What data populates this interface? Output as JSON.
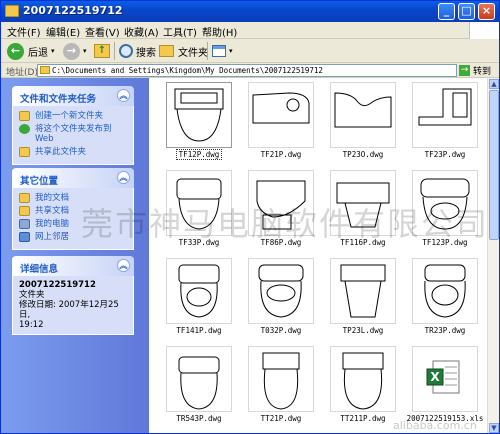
{
  "window": {
    "title": "2007122519712"
  },
  "menu": [
    "文件(F)",
    "编辑(E)",
    "查看(V)",
    "收藏(A)",
    "工具(T)",
    "帮助(H)"
  ],
  "toolbar": {
    "back": "后退",
    "search": "搜索",
    "folders": "文件夹"
  },
  "address": {
    "label": "地址(D)",
    "path": "C:\\Documents and Settings\\Kingdom\\My Documents\\2007122519712",
    "go": "转到"
  },
  "tasks": {
    "title": "文件和文件夹任务",
    "items": [
      "创建一个新文件夹",
      "将这个文件夹发布到",
      "Web",
      "共享此文件夹"
    ]
  },
  "places": {
    "title": "其它位置",
    "items": [
      "我的文档",
      "共享文档",
      "我的电脑",
      "网上邻居"
    ]
  },
  "details": {
    "title": "详细信息",
    "name": "2007122519712",
    "type": "文件夹",
    "modified": "修改日期: 2007年12月25日,",
    "time": "19:12"
  },
  "files": [
    {
      "name": "TF12P.dwg",
      "selected": true
    },
    {
      "name": "TF21P.dwg"
    },
    {
      "name": "TP23O.dwg"
    },
    {
      "name": "TF23P.dwg"
    },
    {
      "name": "TF33P.dwg"
    },
    {
      "name": "TF86P.dwg"
    },
    {
      "name": "TF116P.dwg"
    },
    {
      "name": "TF123P.dwg"
    },
    {
      "name": "TF141P.dwg"
    },
    {
      "name": "T032P.dwg"
    },
    {
      "name": "TP23L.dwg"
    },
    {
      "name": "TR23P.dwg"
    },
    {
      "name": "TR543P.dwg"
    },
    {
      "name": "TT21P.dwg"
    },
    {
      "name": "TT211P.dwg"
    },
    {
      "name": "2007122519153.xls"
    }
  ],
  "watermark": "莞市神马电脑软件有限公司",
  "corner_watermark": "alibaba.com.cn"
}
